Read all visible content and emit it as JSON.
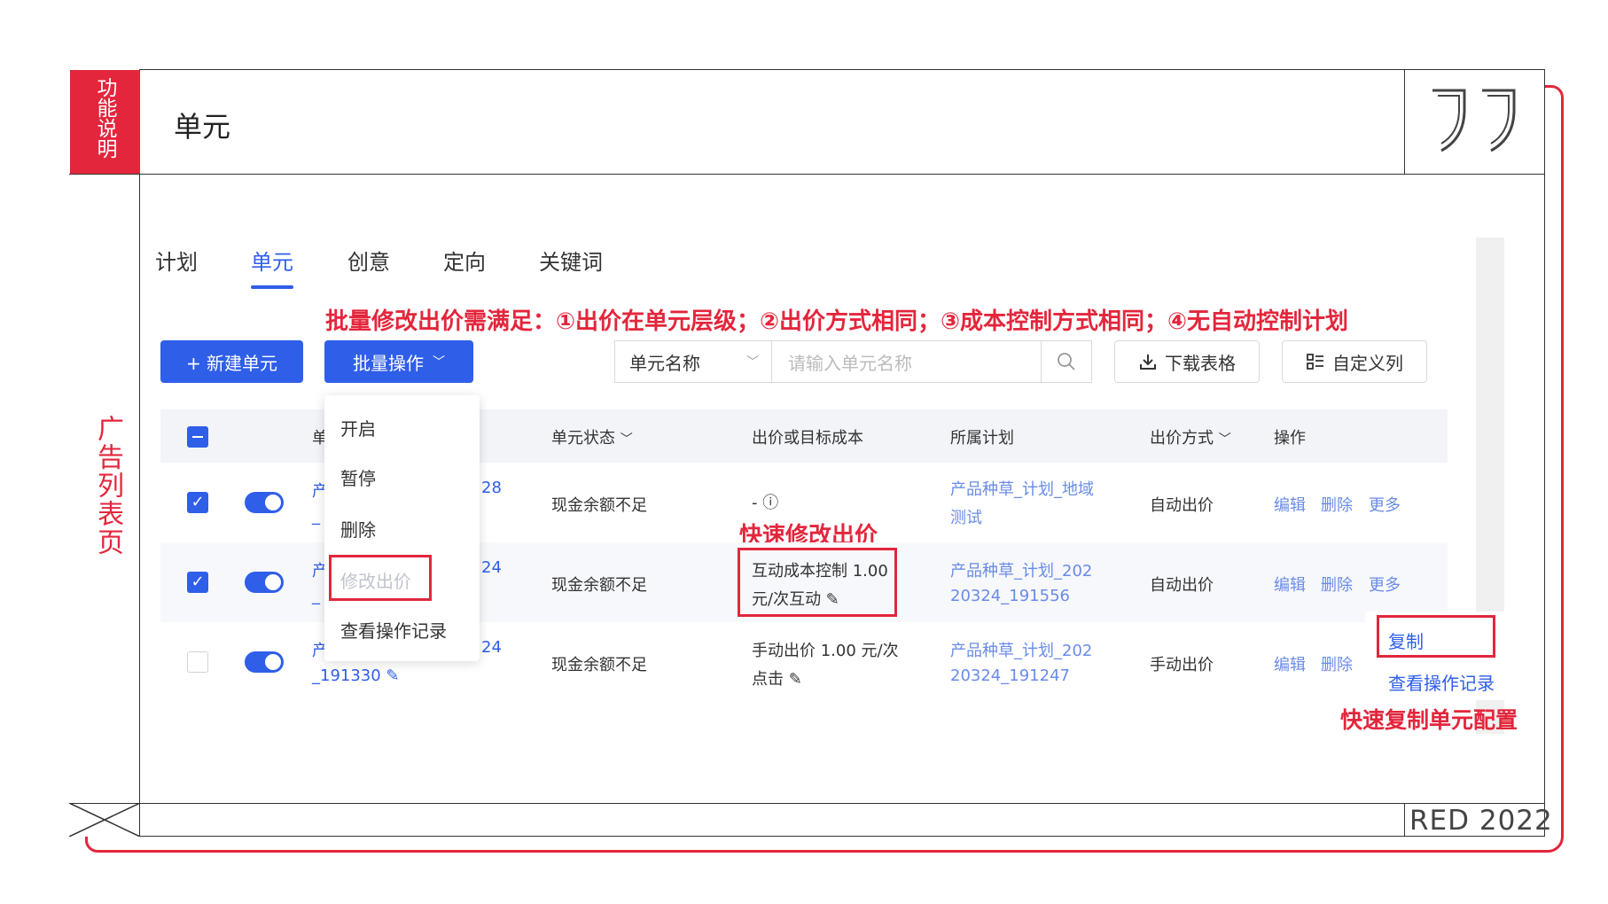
{
  "sidebar": {
    "tag_text": "功能说明",
    "section_label": "广告列表页"
  },
  "header": {
    "title": "单元",
    "quote_mark": "””"
  },
  "footer": {
    "brand": "RED 2022"
  },
  "tabs": [
    {
      "label": "计划",
      "active": false
    },
    {
      "label": "单元",
      "active": true
    },
    {
      "label": "创意",
      "active": false
    },
    {
      "label": "定向",
      "active": false
    },
    {
      "label": "关键词",
      "active": false
    }
  ],
  "annotations": {
    "batch_note": "批量修改出价需满足：①出价在单元层级；②出价方式相同；③成本控制方式相同；④无自动控制计划",
    "quick_bid": "快速修改出价",
    "quick_copy": "快速复制单元配置"
  },
  "toolbar": {
    "new_unit": "+ 新建单元",
    "batch_ops": "批量操作",
    "filter_select": "单元名称",
    "search_placeholder": "请输入单元名称",
    "download": "下载表格",
    "custom_columns": "自定义列"
  },
  "batch_menu": {
    "items": [
      "开启",
      "暂停",
      "删除",
      "修改出价",
      "查看操作记录"
    ]
  },
  "table": {
    "headers": {
      "name": "单",
      "status": "单元状态",
      "bid": "出价或目标成本",
      "plan": "所属计划",
      "bid_mode": "出价方式",
      "ops": "操作"
    },
    "rows": [
      {
        "name_a": "产",
        "name_b": "28",
        "name_c": "_",
        "status": "现金余额不足",
        "bid_1": "- ⓘ",
        "bid_2": "",
        "plan_1": "产品种草_计划_地域",
        "plan_2": "测试",
        "bid_mode": "自动出价",
        "op_edit": "编辑",
        "op_delete": "删除",
        "op_more": "更多"
      },
      {
        "name_a": "产",
        "name_b": "24",
        "name_c": "_",
        "status": "现金余额不足",
        "bid_1": "互动成本控制 1.00",
        "bid_2": "元/次互动 ✎",
        "plan_1": "产品种草_计划_202",
        "plan_2": "20324_191556",
        "bid_mode": "自动出价",
        "op_edit": "编辑",
        "op_delete": "删除",
        "op_more": "更多"
      },
      {
        "name_a": "产",
        "name_b": "24",
        "name_c": "_191330 ✎",
        "status": "现金余额不足",
        "bid_1": "手动出价 1.00 元/次",
        "bid_2": "点击 ✎",
        "plan_1": "产品种草_计划_202",
        "plan_2": "20324_191247",
        "bid_mode": "手动出价",
        "op_edit": "编辑",
        "op_delete": "删除",
        "op_more": ""
      }
    ]
  },
  "more_menu": {
    "items": [
      "复制",
      "查看操作记录"
    ]
  },
  "colors": {
    "accent_red": "#e3263c",
    "primary_blue": "#2f5ee8"
  }
}
